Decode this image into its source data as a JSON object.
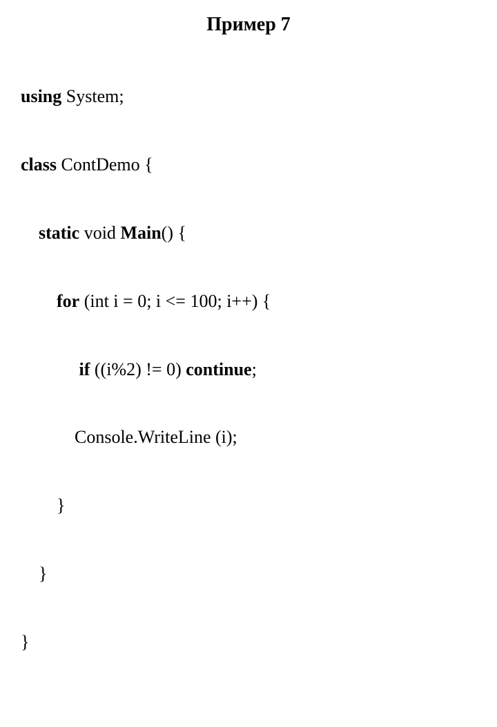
{
  "title": "Пример 7",
  "code": {
    "l1": {
      "kw": "using",
      "rest": " System;"
    },
    "l2": {
      "kw": "class",
      "rest": " ContDemo {"
    },
    "l3": {
      "indent": "    ",
      "kw1": "static",
      "mid": " void ",
      "kw2": "Main",
      "rest": "() {"
    },
    "l4": {
      "indent": "        ",
      "kw": "for",
      "rest": " (int i = 0; i <= 100; i++) {"
    },
    "l5": {
      "indent": "             ",
      "kw1": "if",
      "mid": " ((i%2) != 0) ",
      "kw2": "continue",
      "rest": ";"
    },
    "l6": {
      "indent": "            ",
      "text": "Console.WriteLine (i);"
    },
    "l7": {
      "indent": "        ",
      "text": "}"
    },
    "l8": {
      "indent": "    ",
      "text": "}"
    },
    "l9": {
      "text": "}"
    }
  }
}
